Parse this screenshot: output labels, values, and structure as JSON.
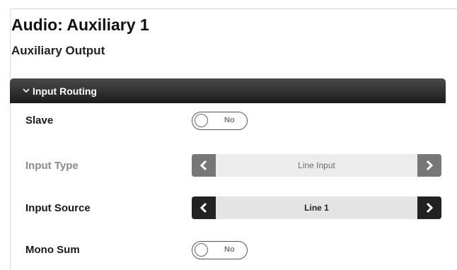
{
  "page": {
    "title": "Audio: Auxiliary 1"
  },
  "section": {
    "title": "Auxiliary Output"
  },
  "group": {
    "label": "Input Routing",
    "chevron": "⌄"
  },
  "rows": {
    "slave": {
      "label": "Slave",
      "toggle_text": "No",
      "state": "off"
    },
    "input_type": {
      "label": "Input Type",
      "value": "Line Input",
      "enabled": false
    },
    "input_source": {
      "label": "Input Source",
      "value": "Line 1",
      "enabled": true
    },
    "mono_sum": {
      "label": "Mono Sum",
      "toggle_text": "No",
      "state": "off"
    }
  },
  "icons": {
    "prev": "chevron-left-icon",
    "next": "chevron-right-icon",
    "collapse": "chevron-down-icon"
  }
}
